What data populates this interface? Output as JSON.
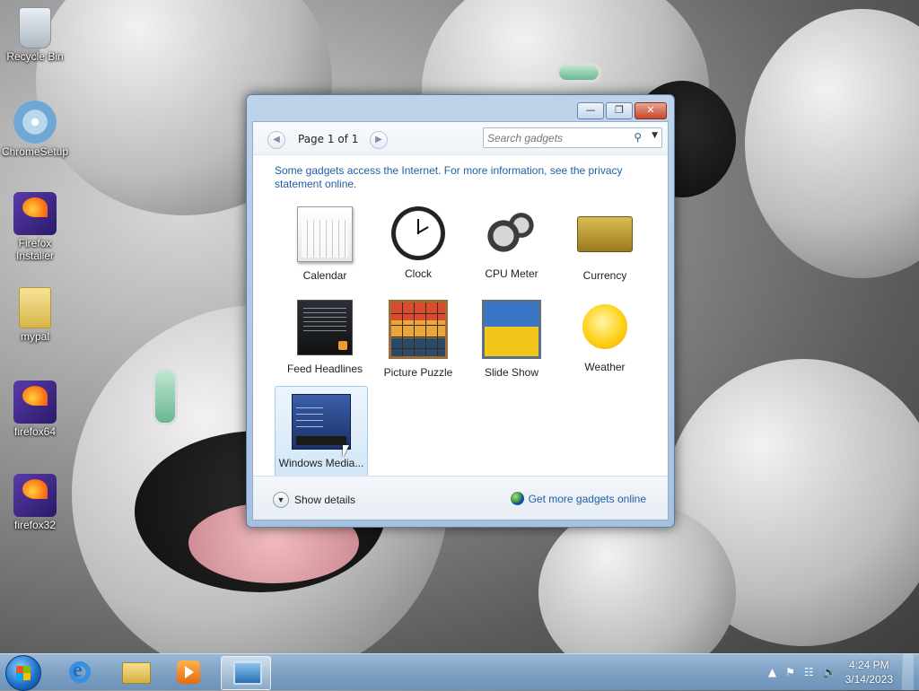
{
  "desktop": {
    "icons": [
      {
        "label": "Recycle Bin"
      },
      {
        "label": "ChromeSetup"
      },
      {
        "label": "Firefox Installer"
      },
      {
        "label": "mypal"
      },
      {
        "label": "firefox64"
      },
      {
        "label": "firefox32"
      }
    ]
  },
  "gadget_window": {
    "page_label": "Page 1 of 1",
    "search_placeholder": "Search gadgets",
    "notice": "Some gadgets access the Internet.  For more information, see the privacy statement online.",
    "gadgets": [
      {
        "label": "Calendar",
        "icon": "calendar-icon"
      },
      {
        "label": "Clock",
        "icon": "clock-icon"
      },
      {
        "label": "CPU Meter",
        "icon": "cpu-meter-icon"
      },
      {
        "label": "Currency",
        "icon": "currency-icon"
      },
      {
        "label": "Feed Headlines",
        "icon": "feed-icon"
      },
      {
        "label": "Picture Puzzle",
        "icon": "puzzle-icon"
      },
      {
        "label": "Slide Show",
        "icon": "slideshow-icon"
      },
      {
        "label": "Weather",
        "icon": "weather-icon"
      },
      {
        "label": "Windows Media...",
        "icon": "windows-media-icon"
      }
    ],
    "show_details": "Show details",
    "get_more": "Get more gadgets online"
  },
  "taskbar": {
    "time": "4:24 PM",
    "date": "3/14/2023"
  }
}
